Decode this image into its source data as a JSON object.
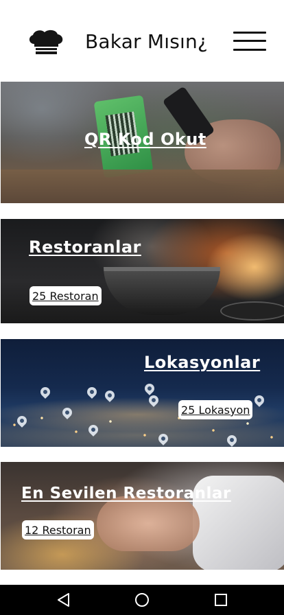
{
  "header": {
    "app_title": "Bakar Mısın¿",
    "logo_icon": "chef-hat-icon",
    "menu_icon": "hamburger-menu-icon"
  },
  "cards": [
    {
      "title": "QR Kod Okut"
    },
    {
      "title": "Restoranlar",
      "badge": "25 Restoran"
    },
    {
      "title": "Lokasyonlar",
      "badge": " 25 Lokasyon"
    },
    {
      "title": "En Sevilen Restoranlar",
      "badge": "12 Restoran"
    }
  ],
  "navbar": {
    "back_icon": "back-triangle-icon",
    "home_icon": "home-circle-icon",
    "recent_icon": "recent-apps-square-icon"
  },
  "colors": {
    "text": "#111111",
    "card_text": "#ffffff",
    "navbar": "#000000",
    "badge_bg": "#ffffff"
  }
}
